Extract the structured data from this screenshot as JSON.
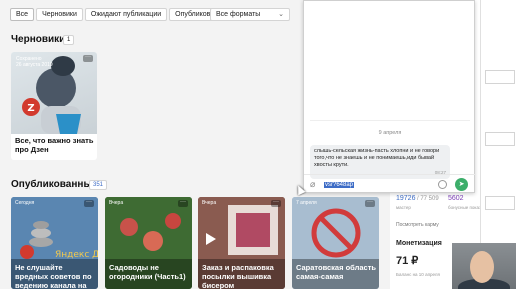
{
  "filters": {
    "tabs": [
      "Все",
      "Черновики",
      "Ожидают публикации",
      "Опубликованные"
    ],
    "format_select": "Все форматы"
  },
  "drafts": {
    "title": "Черновики",
    "count": "1",
    "card": {
      "badge_line1": "Сохранено",
      "badge_line2": "26 августа 2019",
      "title": "Все, что важно знать про Дзен"
    }
  },
  "published": {
    "title": "Опубликованные",
    "count": "351",
    "cards": [
      {
        "date": "Сегодня",
        "title": "Не слушайте вредных советов по ведению канала на ДЗЕН",
        "bg": "#4d78a6",
        "img_text": "Яндекс Дзен"
      },
      {
        "date": "Вчера",
        "title": "Садоводы не огородники (Часть1)",
        "bg": "#3e6b33"
      },
      {
        "date": "Вчера",
        "title": "Заказ и распаковка посылки вышивка бисером",
        "bg": "#7b5249"
      },
      {
        "date": "7 апреля",
        "title": "Саратовская область самая-самая",
        "bg": "#9fb4c9"
      }
    ]
  },
  "chat": {
    "date": "9 апреля",
    "message": "слышь-сельская жизнь-пасть хлопни и не говори того,что не знаешь и не понимаешь,иди бывай хвосты крути.",
    "message_time": "08:27",
    "input_text": "vsr?648ap"
  },
  "stats": {
    "views": "19726",
    "views_total": "/ 77 509",
    "views_label": "мастер",
    "bonus": "5602",
    "bonus_label": "бонусные показы",
    "link": "Посмотреть карму",
    "monetization_title": "Монетизация",
    "monetization_value": "71 ₽",
    "monetization_note": "Баланс на 10 апреля"
  },
  "colors": {
    "accent": "#3d6cc6",
    "send": "#3cae6a"
  }
}
